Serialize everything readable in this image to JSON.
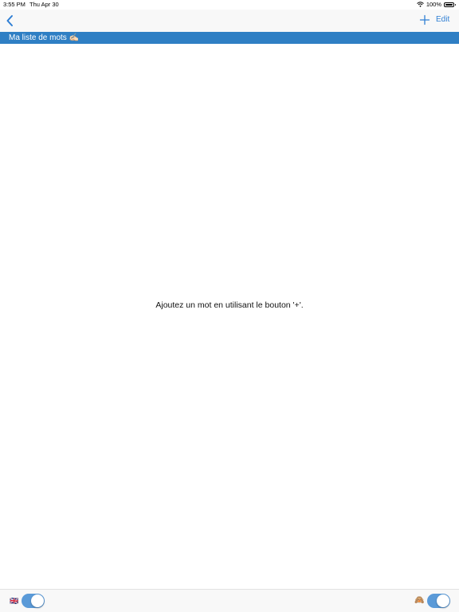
{
  "status_bar": {
    "time": "3:55 PM",
    "date": "Thu Apr 30",
    "battery": "100%"
  },
  "nav": {
    "back_icon": "chevron-left-icon",
    "add_label": "+",
    "edit_label": "Edit",
    "accent_color": "#2f7fd4"
  },
  "title_bar": {
    "title": "Ma liste de mots ✍🏻",
    "background_color": "#2f7fc4"
  },
  "main": {
    "empty_message": "Ajoutez un mot en utilisant le bouton '+'."
  },
  "bottom_bar": {
    "left_flag": "🇬🇧",
    "left_toggle_on": true,
    "right_emoji": "🙈",
    "right_toggle_on": true
  }
}
